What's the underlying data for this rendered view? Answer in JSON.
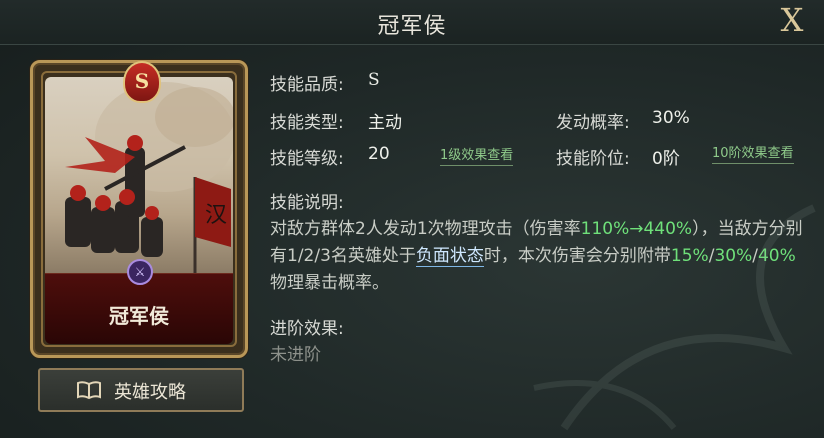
{
  "header": {
    "title": "冠军侯",
    "close_label": "X"
  },
  "card": {
    "rank": "S",
    "name": "冠军侯",
    "flag_char": "汉"
  },
  "guide_button": {
    "label": "英雄攻略"
  },
  "info": {
    "quality_label": "技能品质:",
    "quality_value": "S",
    "type_label": "技能类型:",
    "type_value": "主动",
    "chance_label": "发动概率:",
    "chance_value": "30%",
    "level_label": "技能等级:",
    "level_value": "20",
    "level_link": "1级效果查看",
    "stage_label": "技能阶位:",
    "stage_value": "0阶",
    "stage_link": "10阶效果查看"
  },
  "description": {
    "label": "技能说明:",
    "p1": "对敌方群体2人发动1次物理攻击（伤害率",
    "p1_hl": "110%→440%",
    "p2": "），当敌方分别有1/2/3名英雄处于",
    "p2_link": "负面状态",
    "p3": "时，本次伤害会分别附带",
    "hl1": "15%",
    "sep1": "/",
    "hl2": "30%",
    "sep2": "/",
    "hl3": "40%",
    "p4": "物理暴击概率。"
  },
  "advance": {
    "label": "进阶效果:",
    "value": "未进阶"
  },
  "colors": {
    "highlight": "#6fe07a",
    "link": "#8fca8a",
    "frame": "#b99758"
  }
}
